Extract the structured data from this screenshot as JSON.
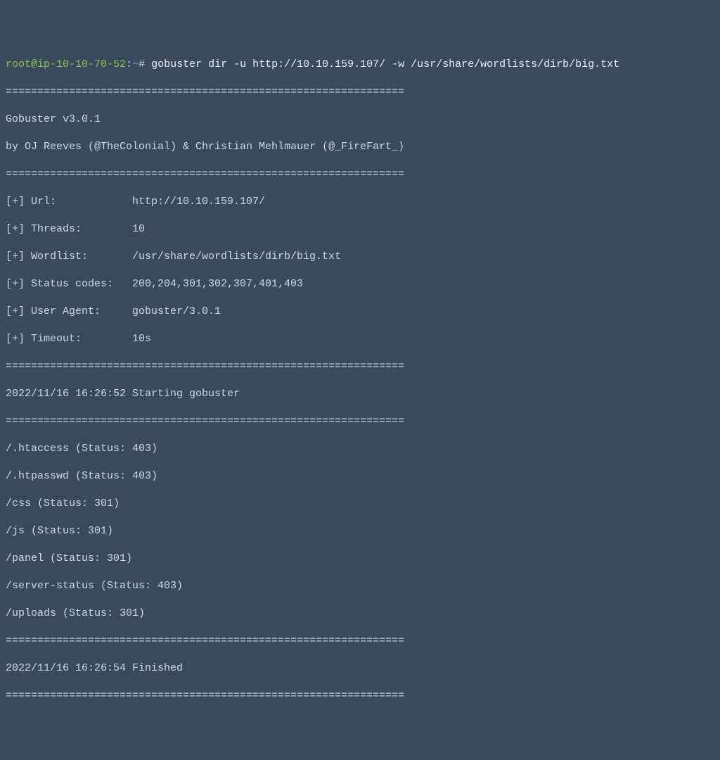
{
  "prompt": {
    "user_host": "root@ip-10-10-70-52",
    "sep1": ":",
    "path": "~",
    "sep2": "# ",
    "command": "gobuster dir -u http://10.10.159.107/ -w /usr/share/wordlists/dirb/big.txt"
  },
  "divider": "===============================================================",
  "banner": {
    "name_version": "Gobuster v3.0.1",
    "byline": "by OJ Reeves (@TheColonial) & Christian Mehlmauer (@_FireFart_)"
  },
  "config": {
    "url": {
      "label": "[+] Url:",
      "value": "http://10.10.159.107/"
    },
    "threads": {
      "label": "[+] Threads:",
      "value": "10"
    },
    "wordlist": {
      "label": "[+] Wordlist:",
      "value": "/usr/share/wordlists/dirb/big.txt"
    },
    "status_codes": {
      "label": "[+] Status codes:",
      "value": "200,204,301,302,307,401,403"
    },
    "user_agent": {
      "label": "[+] User Agent:",
      "value": "gobuster/3.0.1"
    },
    "timeout": {
      "label": "[+] Timeout:",
      "value": "10s"
    }
  },
  "start_line": "2022/11/16 16:26:52 Starting gobuster",
  "results": [
    "/.htaccess (Status: 403)",
    "/.htpasswd (Status: 403)",
    "/css (Status: 301)",
    "/js (Status: 301)",
    "/panel (Status: 301)",
    "/server-status (Status: 403)",
    "/uploads (Status: 301)"
  ],
  "finish_line": "2022/11/16 16:26:54 Finished"
}
